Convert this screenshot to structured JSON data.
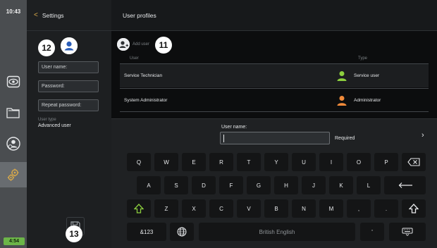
{
  "status": {
    "clock": "10:43",
    "battery": "4:54"
  },
  "rail": {
    "items": [
      "eye-icon",
      "folder-icon",
      "user-settings-icon",
      "gears-icon"
    ],
    "active": "gears-icon"
  },
  "left_panel": {
    "back_label": "Settings",
    "badge": "12",
    "fields": [
      {
        "label": "User name:"
      },
      {
        "label": "Password:"
      },
      {
        "label": "Repeat password:"
      }
    ],
    "user_type_label": "User type",
    "user_type_value": "Advanced user",
    "save_badge": "13"
  },
  "main": {
    "title": "User profiles",
    "add_user_label": "Add user",
    "add_user_badge": "11",
    "columns": {
      "user": "User",
      "type": "Type"
    },
    "rows": [
      {
        "user": "Service Technician",
        "type": "Service user",
        "icon_color": "#8ccf3e"
      },
      {
        "user": "System Administrator",
        "type": "Administrator",
        "icon_color": "#f08a3a"
      }
    ]
  },
  "keyboard": {
    "input_label": "User name:",
    "input_value": "",
    "required_label": "Required",
    "row1": [
      "Q",
      "W",
      "E",
      "R",
      "T",
      "Y",
      "U",
      "I",
      "O",
      "P"
    ],
    "row2": [
      "A",
      "S",
      "D",
      "F",
      "G",
      "H",
      "J",
      "K",
      "L"
    ],
    "row3": [
      "Z",
      "X",
      "C",
      "V",
      "B",
      "N",
      "M",
      ",",
      "."
    ],
    "mode_key": "&123",
    "space_label": "British English",
    "apostrophe": "'"
  },
  "colors": {
    "accent": "#d8a94a",
    "shift": "#8ccf3e",
    "service": "#8ccf3e",
    "admin": "#f08a3a",
    "battery": "#6cb548"
  }
}
